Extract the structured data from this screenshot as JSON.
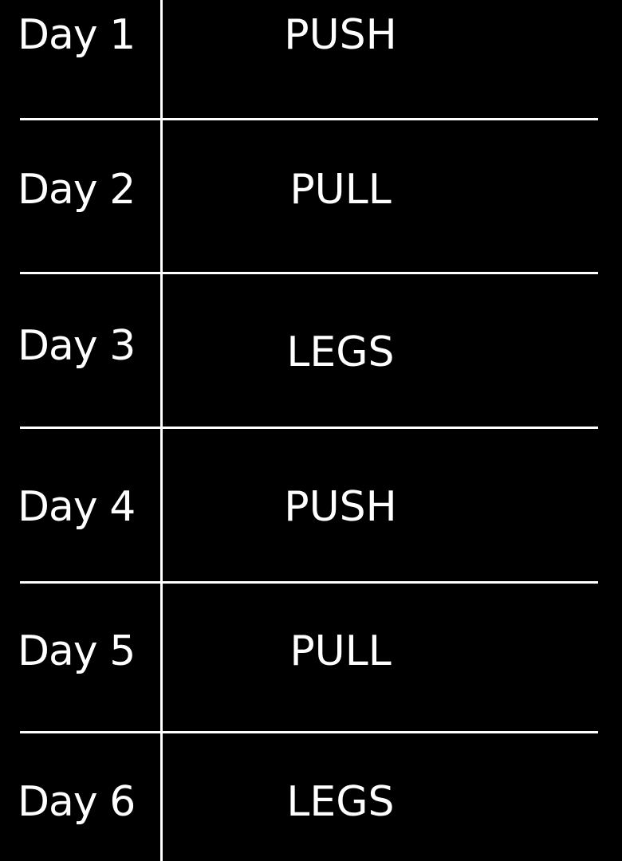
{
  "schedule": {
    "rows": [
      {
        "day": "Day 1",
        "workout": "PUSH"
      },
      {
        "day": "Day 2",
        "workout": "PULL"
      },
      {
        "day": "Day 3",
        "workout": "LEGS"
      },
      {
        "day": "Day 4",
        "workout": "PUSH"
      },
      {
        "day": "Day 5",
        "workout": "PULL"
      },
      {
        "day": "Day 6",
        "workout": "LEGS"
      }
    ]
  },
  "colors": {
    "background": "#000000",
    "foreground": "#ffffff"
  }
}
